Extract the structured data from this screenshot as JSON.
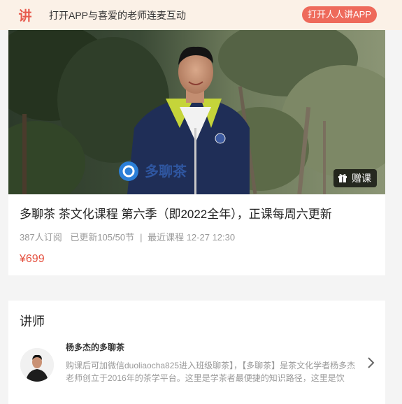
{
  "banner": {
    "logo_char": "讲",
    "text": "打开APP与喜爱的老师连麦互动",
    "open_button": "打开人人讲APP"
  },
  "video": {
    "watermark_text": "多聊茶",
    "gift_label": "赠课"
  },
  "course": {
    "title": "多聊茶 茶文化课程 第六季（即2022全年），正课每周六更新",
    "subscribers": "387人订阅",
    "updated": "已更新105/50节",
    "recent": "最近课程 12-27 12:30",
    "price": "¥699"
  },
  "teacher": {
    "heading": "讲师",
    "name": "杨多杰的多聊茶",
    "description": "购课后可加微信duoliaocha825进入班级聊茶】，【多聊茶】是茶文化学者杨多杰老师创立于2016年的茶学平台。这里是学茶者最便捷的知识路径，这里是饮"
  },
  "colors": {
    "accent": "#ee6a5b",
    "banner_bg": "#fbf1e7",
    "price": "#e5503f"
  }
}
